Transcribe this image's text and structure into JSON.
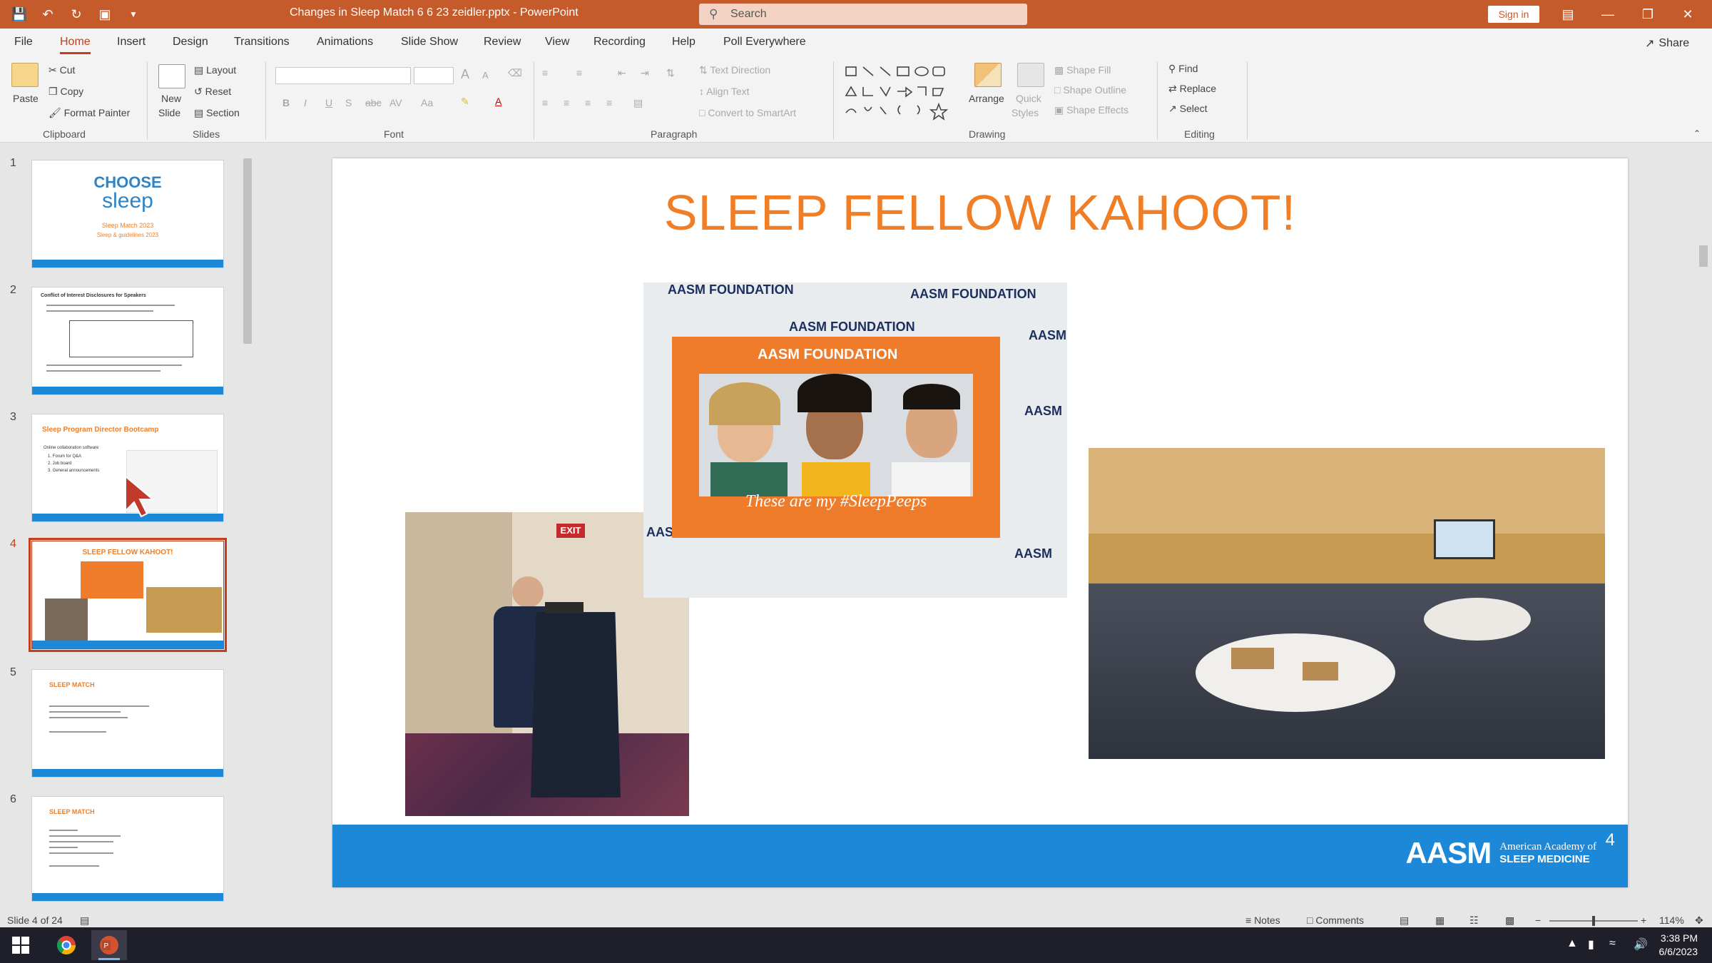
{
  "window": {
    "title": "Changes in Sleep Match 6 6 23 zeidler.pptx  -  PowerPoint",
    "search_placeholder": "Search",
    "sign_in": "Sign in",
    "share": "Share"
  },
  "menu": [
    "File",
    "Home",
    "Insert",
    "Design",
    "Transitions",
    "Animations",
    "Slide Show",
    "Review",
    "View",
    "Recording",
    "Help",
    "Poll Everywhere"
  ],
  "ribbon": {
    "clipboard": {
      "paste": "Paste",
      "cut": "Cut",
      "copy": "Copy",
      "format_painter": "Format Painter",
      "group": "Clipboard"
    },
    "slides": {
      "new_slide_1": "New",
      "new_slide_2": "Slide",
      "layout": "Layout",
      "reset": "Reset",
      "section": "Section",
      "group": "Slides"
    },
    "font": {
      "group": "Font",
      "bold": "B",
      "italic": "I",
      "underline": "U",
      "strike": "S",
      "shadow": "abc",
      "spacing": "AV",
      "case": "Aa",
      "grow": "A",
      "shrink": "A"
    },
    "paragraph": {
      "group": "Paragraph",
      "text_direction": "Text Direction",
      "align_text": "Align Text",
      "convert_smartart": "Convert to SmartArt"
    },
    "drawing": {
      "group": "Drawing",
      "arrange": "Arrange",
      "quick_styles_1": "Quick",
      "quick_styles_2": "Styles",
      "shape_fill": "Shape Fill",
      "shape_outline": "Shape Outline",
      "shape_effects": "Shape Effects"
    },
    "editing": {
      "group": "Editing",
      "find": "Find",
      "replace": "Replace",
      "select": "Select"
    }
  },
  "thumbnails": [
    {
      "num": "1",
      "title_a": "CHOOSE",
      "title_b": "sleep",
      "line1": "Sleep Match 2023",
      "line2": "Sleep & guidelines 2023"
    },
    {
      "num": "2",
      "title": "Conflict of Interest Disclosures for Speakers"
    },
    {
      "num": "3",
      "title": "Sleep Program Director Bootcamp",
      "line1": "Online collaboration software",
      "line2": "1. Forum for Q&A",
      "line3": "2. Job board",
      "line4": "3. General announcements"
    },
    {
      "num": "4",
      "title": "SLEEP FELLOW KAHOOT!"
    },
    {
      "num": "5",
      "title": "SLEEP MATCH"
    },
    {
      "num": "6",
      "title": "SLEEP MATCH"
    }
  ],
  "slide": {
    "title": "SLEEP FELLOW KAHOOT!",
    "frame_caption": "These are my #SleepPeeps",
    "frame_header": "AASM  FOUNDATION",
    "backdrop_words": [
      "AASM FOUNDATION",
      "AASM FOUNDATION",
      "AASM FOUNDATION",
      "AASM",
      "AASM",
      "AASM",
      "AASM"
    ],
    "exit_sign": "EXIT",
    "logo_big": "AASM",
    "logo_small_1": "American Academy of",
    "logo_small_2": "SLEEP MEDICINE",
    "number": "4"
  },
  "status": {
    "slide_of": "Slide 4 of 24",
    "notes": "Notes",
    "comments": "Comments",
    "zoom": "114%"
  },
  "clock": {
    "time": "3:38 PM",
    "date": "6/6/2023"
  },
  "colors": {
    "title_bar": "#c55a2b",
    "accent": "#c43e1c",
    "slide_title": "#f07e26",
    "slide_footer": "#1e88d8"
  }
}
